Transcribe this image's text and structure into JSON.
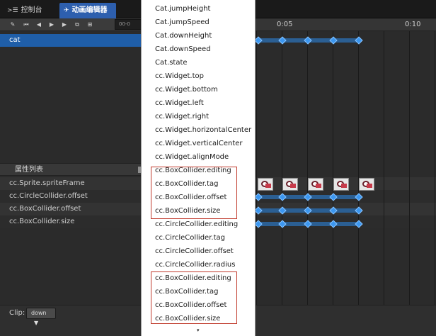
{
  "tabs": {
    "console_label": "控制台",
    "console_icon": "terminal-icon",
    "animation_editor_label": "动画编辑器",
    "animation_editor_icon": "running-figure-icon"
  },
  "toolbar": {
    "icons": [
      "edit-icon",
      "jump-to-start-icon",
      "previous-frame-icon",
      "play-icon",
      "next-frame-icon",
      "add-event-icon",
      "add-clip-icon"
    ],
    "time_value": "00-0"
  },
  "node_tree": {
    "selected_node": "cat"
  },
  "properties": {
    "header": "属性列表",
    "items": [
      "cc.Sprite.spriteFrame",
      "cc.CircleCollider.offset",
      "cc.BoxCollider.offset",
      "cc.BoxCollider.size"
    ]
  },
  "clip": {
    "label": "Clip:",
    "value": "down",
    "arrow": "▼"
  },
  "menu": {
    "items": [
      "Cat.jumpHeight",
      "Cat.jumpSpeed",
      "Cat.downHeight",
      "Cat.downSpeed",
      "Cat.state",
      "cc.Widget.top",
      "cc.Widget.bottom",
      "cc.Widget.left",
      "cc.Widget.right",
      "cc.Widget.horizontalCenter",
      "cc.Widget.verticalCenter",
      "cc.Widget.alignMode",
      "cc.BoxCollider.editing",
      "cc.BoxCollider.tag",
      "cc.BoxCollider.offset",
      "cc.BoxCollider.size",
      "cc.CircleCollider.editing",
      "cc.CircleCollider.tag",
      "cc.CircleCollider.offset",
      "cc.CircleCollider.radius",
      "cc.BoxCollider.editing",
      "cc.BoxCollider.tag",
      "cc.BoxCollider.offset",
      "cc.BoxCollider.size"
    ],
    "more_arrow": "▾"
  },
  "timeline": {
    "ruler_labels": [
      "0:05",
      "0:10"
    ]
  },
  "colors": {
    "accent": "#2d5fae",
    "keyframe": "#3c97f0",
    "highlight_box": "#c0392b"
  }
}
